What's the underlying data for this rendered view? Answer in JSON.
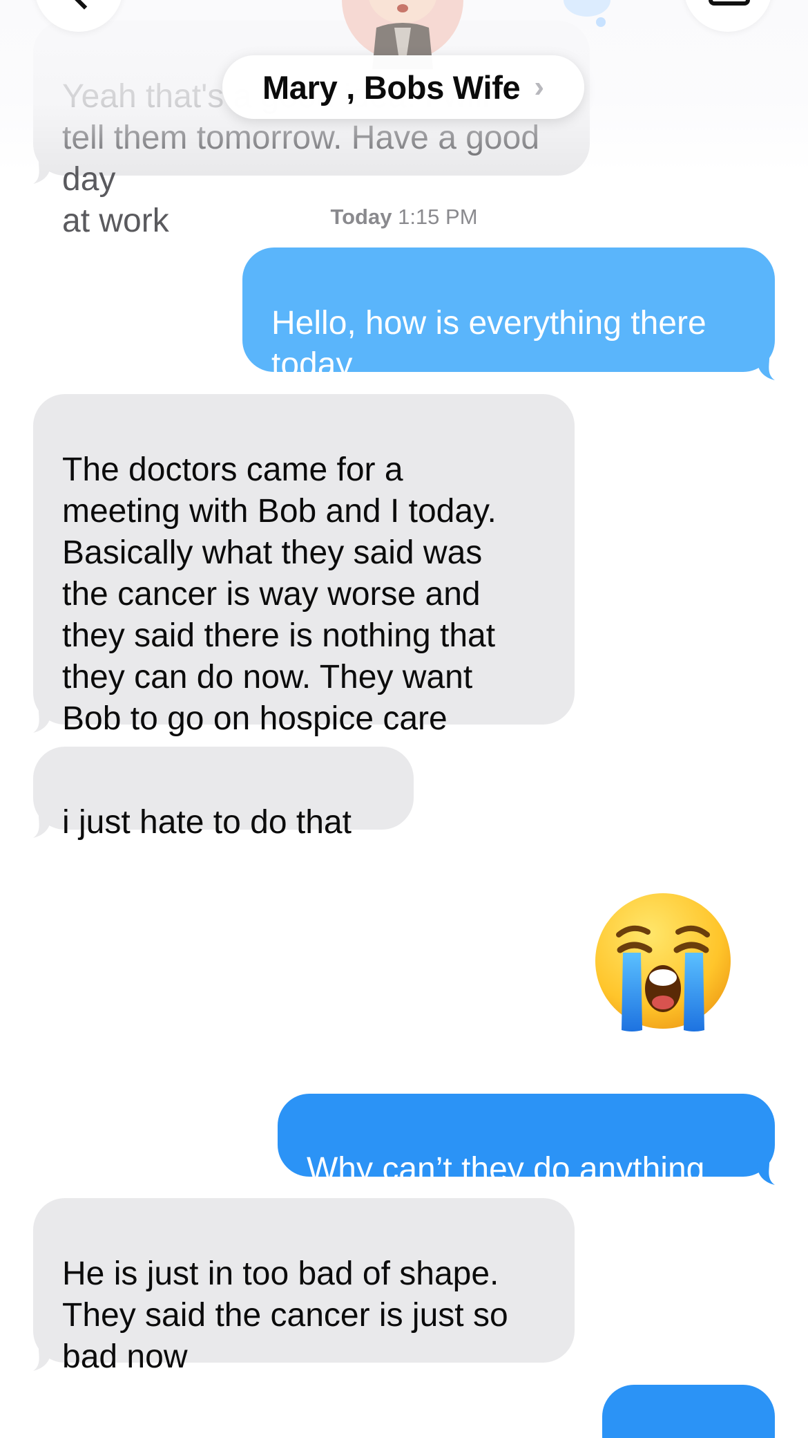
{
  "header": {
    "contact_name": "Mary , Bobs Wife",
    "chevron": "›",
    "back_icon": "chevron-left-icon",
    "video_icon": "video-camera-icon"
  },
  "timestamp": {
    "day": "Today",
    "time": "1:15 PM"
  },
  "messages": [
    {
      "direction": "received",
      "text": "Yeah that's a good idea. I will\ntell them tomorrow. Have a good day\nat work"
    },
    {
      "direction": "sent",
      "text": "Hello, how is everything there\ntoday"
    },
    {
      "direction": "received",
      "text": "The doctors came for a\nmeeting with Bob and I today.\nBasically what they said was\nthe cancer is way worse and\nthey said there is nothing that\nthey can do now.  They want\nBob to go on hospice care"
    },
    {
      "direction": "received",
      "text": "i just hate to do that"
    },
    {
      "direction": "sent",
      "text": "😭",
      "type": "emoji",
      "emoji_name": "loudly-crying-face"
    },
    {
      "direction": "sent",
      "text": "Why can’t they do anything"
    },
    {
      "direction": "received",
      "text": "He is just in too bad of shape.\nThey said the cancer is just so\nbad now"
    },
    {
      "direction": "sent",
      "text": ""
    }
  ],
  "colors": {
    "sent_bubble": "#2b93f6",
    "sent_bubble_light": "#5ab5fb",
    "received_bubble": "#e9e9eb",
    "received_text": "#0b0b0b",
    "timestamp_text": "#8a8a8e"
  }
}
